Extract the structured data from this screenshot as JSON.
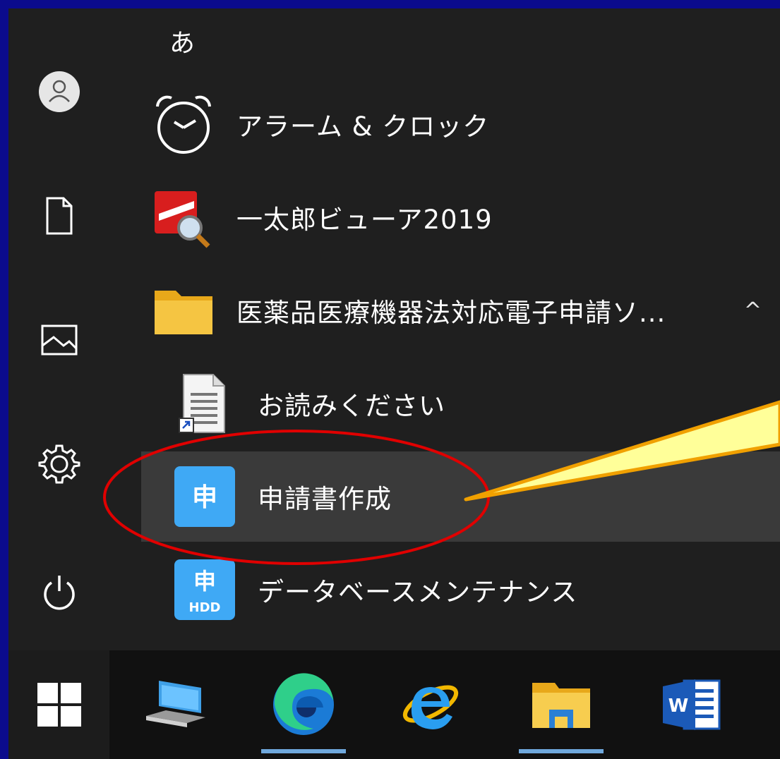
{
  "start_menu": {
    "section_letter": "あ",
    "items": [
      {
        "label": "アラーム & クロック",
        "icon": "alarm-clock-icon"
      },
      {
        "label": "一太郎ビューア2019",
        "icon": "ichitaro-viewer-icon"
      },
      {
        "label": "医薬品医療機器法対応電子申請ソ...",
        "icon": "folder-icon",
        "expanded": true,
        "chevron": "^"
      },
      {
        "label": "お読みください",
        "icon": "readme-document-icon"
      },
      {
        "label": "申請書作成",
        "icon": "shinsei-app-icon",
        "icon_text": "申",
        "highlighted": true
      },
      {
        "label": "データベースメンテナンス",
        "icon": "database-maintenance-icon",
        "icon_text": "申",
        "icon_subtext": "HDD"
      }
    ]
  },
  "rail": {
    "icons": [
      "user-account-icon",
      "documents-icon",
      "pictures-icon",
      "settings-icon",
      "power-icon"
    ]
  },
  "taskbar": {
    "start_icon": "windows-start-icon",
    "apps": [
      {
        "name": "this-pc-icon",
        "active": false
      },
      {
        "name": "edge-icon",
        "active": true
      },
      {
        "name": "internet-explorer-icon",
        "active": false
      },
      {
        "name": "file-explorer-icon",
        "active": true
      },
      {
        "name": "word-icon",
        "active": false,
        "icon_text": "W"
      }
    ]
  },
  "colors": {
    "frame_border": "#0b0b8c",
    "menu_bg": "#1f1f1f",
    "highlight_bg": "#3a3a3a",
    "app_icon_blue": "#3fa9f5",
    "annotation_red": "#e00000",
    "callout_fill": "#ffff99",
    "callout_stroke": "#f0a000",
    "folder_yellow": "#f5c542"
  }
}
